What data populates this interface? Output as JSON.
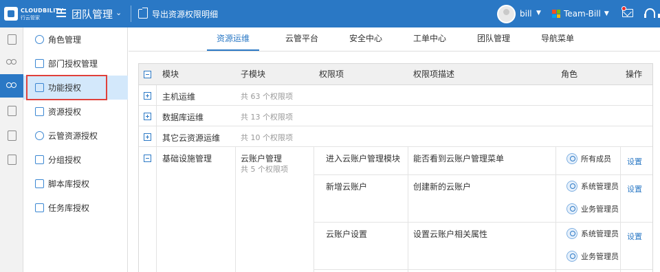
{
  "header": {
    "logo_text": "CLOUDBILITY",
    "logo_sub": "行云管家",
    "title": "团队管理",
    "export_label": "导出资源权限明细",
    "user_name": "bill",
    "team_name": "Team-Bill",
    "brand_color": "#2a78c5",
    "icons": [
      "menu-icon",
      "chevron-down-icon",
      "export-icon",
      "avatar",
      "windows-logo-icon",
      "message-icon",
      "headset-icon"
    ]
  },
  "rail": {
    "icons": [
      "document-icon",
      "users-icon",
      "team-icon",
      "resource-icon",
      "clipboard-icon",
      "book-icon"
    ],
    "active_index": 2
  },
  "sidebar": {
    "items": [
      {
        "label": "角色管理",
        "icon": "users-icon"
      },
      {
        "label": "部门授权管理",
        "icon": "org-chart-icon"
      },
      {
        "label": "功能授权",
        "icon": "function-icon"
      },
      {
        "label": "资源授权",
        "icon": "monitor-icon"
      },
      {
        "label": "云管资源授权",
        "icon": "cloud-icon"
      },
      {
        "label": "分组授权",
        "icon": "folder-icon"
      },
      {
        "label": "脚本库授权",
        "icon": "script-icon"
      },
      {
        "label": "任务库授权",
        "icon": "task-icon"
      }
    ],
    "active_index": 2
  },
  "tabs": [
    {
      "label": "资源运维"
    },
    {
      "label": "云管平台"
    },
    {
      "label": "安全中心"
    },
    {
      "label": "工单中心"
    },
    {
      "label": "团队管理"
    },
    {
      "label": "导航菜单"
    }
  ],
  "active_tab": 0,
  "table": {
    "headers": {
      "module": "模块",
      "submodule": "子模块",
      "perm": "权限项",
      "desc": "权限项描述",
      "role": "角色",
      "op": "操作"
    },
    "collapsed_rows": [
      {
        "module": "主机运维",
        "summary": "共 63 个权限项"
      },
      {
        "module": "数据库运维",
        "summary": "共 13 个权限项"
      },
      {
        "module": "其它云资源运维",
        "summary": "共 10 个权限项"
      }
    ],
    "expanded": {
      "module": "基础设施管理",
      "submodule": "云账户管理",
      "sub_summary": "共 5 个权限项",
      "perms": [
        {
          "name": "进入云账户管理模块",
          "desc": "能否看到云账户管理菜单",
          "roles": [
            "所有成员"
          ],
          "action": "设置"
        },
        {
          "name": "新增云账户",
          "desc": "创建新的云账户",
          "roles": [
            "系统管理员",
            "业务管理员"
          ],
          "action": "设置"
        },
        {
          "name": "云账户设置",
          "desc": "设置云账户相关属性",
          "roles": [
            "系统管理员",
            "业务管理员"
          ],
          "action": "设置"
        }
      ]
    }
  }
}
